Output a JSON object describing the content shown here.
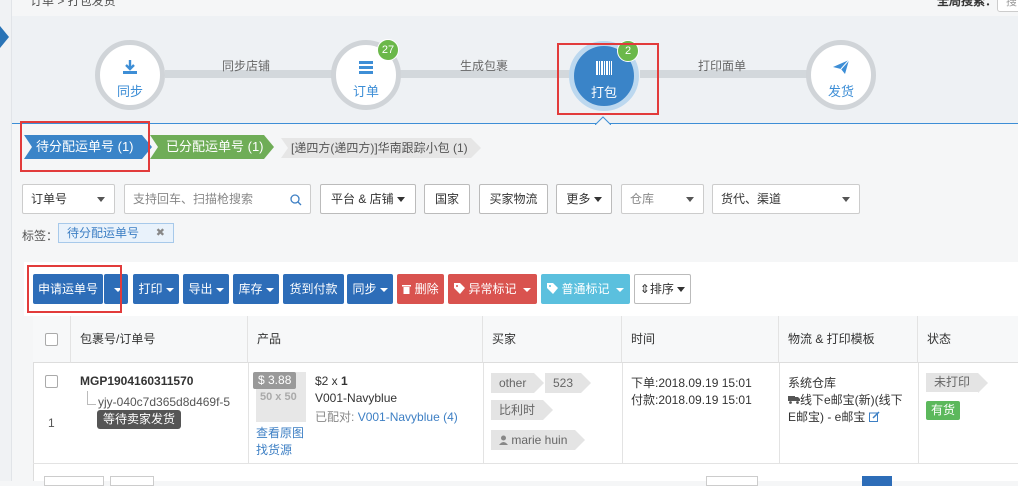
{
  "header": {
    "breadcrumb": "订单 > 打包发货",
    "global_search_label": "全局搜索：",
    "global_search_value": "搜"
  },
  "flow": {
    "steps": [
      {
        "label": "同步",
        "icon": "download-icon"
      },
      {
        "label": "订单",
        "icon": "list-icon",
        "badge": "27"
      },
      {
        "label": "打包",
        "icon": "barcode-icon",
        "badge": "2"
      },
      {
        "label": "发货",
        "icon": "paper-plane-icon"
      }
    ],
    "connectors": [
      "同步店铺",
      "生成包裹",
      "打印面单"
    ]
  },
  "tabs": {
    "pending": "待分配运单号 (1)",
    "assigned": "已分配运单号 (1)",
    "channel": "[递四方(递四方)]华南跟踪小包 (1)"
  },
  "filters": {
    "order_no": "订单号",
    "search_placeholder": "支持回车、扫描枪搜索",
    "platform_store": "平台 & 店铺",
    "country": "国家",
    "buyer_logistics": "买家物流",
    "more": "更多",
    "warehouse": "仓库",
    "forwarder_channel": "货代、渠道"
  },
  "tags": {
    "label": "标签：",
    "chip": "待分配运单号",
    "chip_close": "✖"
  },
  "toolbar": {
    "apply_tracking": "申请运单号",
    "print": "打印",
    "export": "导出",
    "stock": "库存",
    "cod": "货到付款",
    "sync": "同步",
    "delete": "删除",
    "abnormal_mark": "异常标记",
    "normal_mark": "普通标记",
    "sort": "排序"
  },
  "table": {
    "headers": [
      "包裹号/订单号",
      "产品",
      "买家",
      "时间",
      "物流 & 打印模板",
      "状态"
    ],
    "rows": [
      {
        "index": "1",
        "package_no": "MGP1904160311570",
        "order_no": "yjy-040c7d365d8d469f-5",
        "order_status": "等待卖家发货",
        "price_badge": "$ 3.88",
        "thumb_size": "50 x 50",
        "unit_price": "$2 x",
        "qty": "1",
        "sku": "V001-Navyblue",
        "matched_label": "已配对:",
        "matched_value": "V001-Navyblue (4)",
        "view_image": "查看原图",
        "find_source": "找货源",
        "buyer_tag": "other",
        "buyer_count": "523",
        "buyer_country": "比利时",
        "buyer_name": "marie huin",
        "order_time": "下单:2018.09.19 15:01",
        "pay_time": "付款:2018.09.19 15:01",
        "warehouse": "系统仓库",
        "logistics_line1": "线下e邮宝(新)(线下",
        "logistics_line2": "E邮宝) - e邮宝",
        "print_status": "未打印",
        "stock_status": "有货"
      }
    ]
  },
  "colors": {
    "primary": "#2d6db8",
    "green": "#6bb84a",
    "danger": "#d9534f",
    "info": "#5bc0de",
    "highlight": "#e23b3b"
  }
}
